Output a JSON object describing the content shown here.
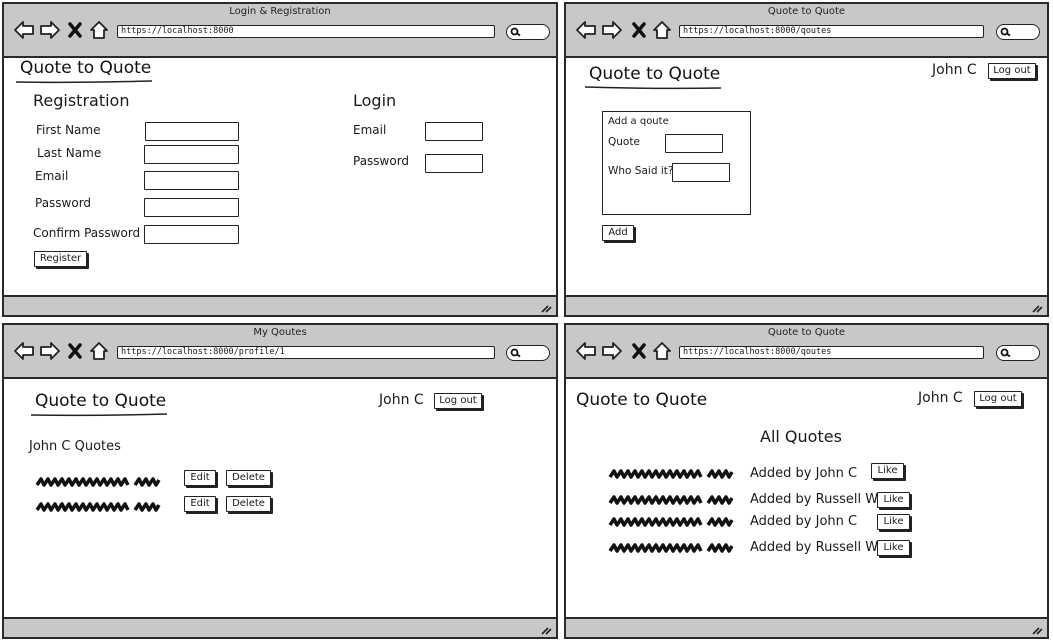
{
  "windows": {
    "login": {
      "title": "Login & Registration",
      "url": "https://localhost:8000",
      "logo": "Quote to Quote",
      "registration": {
        "heading": "Registration",
        "first_name": "First Name",
        "last_name": "Last Name",
        "email": "Email",
        "password": "Password",
        "confirm_password": "Confirm Password",
        "register_button": "Register"
      },
      "login": {
        "heading": "Login",
        "email": "Email",
        "password": "Password"
      }
    },
    "add_quote": {
      "title": "Quote to Quote",
      "url": "https://localhost:8000/qoutes",
      "logo": "Quote to Quote",
      "user_name": "John C",
      "logout_button": "Log out",
      "form": {
        "heading": "Add a qoute",
        "quote_label": "Quote",
        "who_label": "Who Said it?",
        "add_button": "Add"
      }
    },
    "profile": {
      "title": "My Qoutes",
      "url": "https://localhost:8000/profile/1",
      "logo": "Quote to Quote",
      "user_name": "John C",
      "logout_button": "Log out",
      "heading": "John C Quotes",
      "items": [
        {
          "edit": "Edit",
          "delete": "Delete"
        },
        {
          "edit": "Edit",
          "delete": "Delete"
        }
      ]
    },
    "all_quotes": {
      "title": "Quote to Quote",
      "url": "https://localhost:8000/qoutes",
      "logo": "Quote to Quote",
      "user_name": "John C",
      "logout_button": "Log out",
      "heading": "All Quotes",
      "items": [
        {
          "added_by": "Added by John C",
          "like": "Like"
        },
        {
          "added_by": "Added by Russell W",
          "like": "Like"
        },
        {
          "added_by": "Added by John C",
          "like": "Like"
        },
        {
          "added_by": "Added by Russell W",
          "like": "Like"
        }
      ]
    }
  }
}
